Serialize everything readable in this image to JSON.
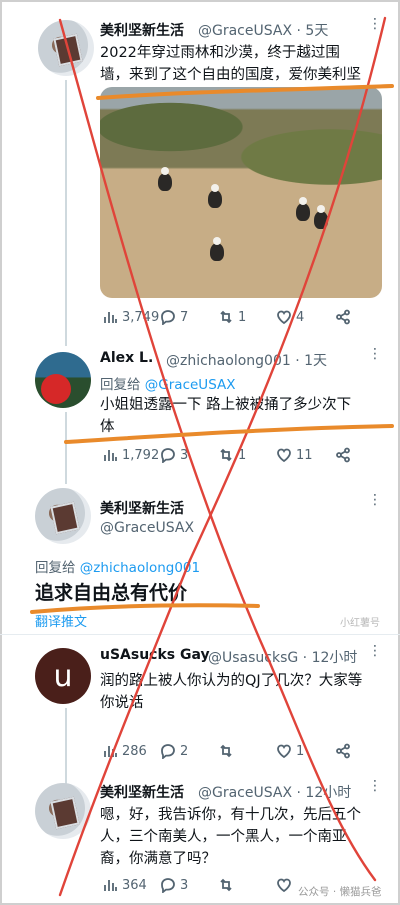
{
  "tweets": [
    {
      "name": "美利坚新生活",
      "handle": "@GraceUSAX · 5天",
      "text_lines": [
        "2022年穿过雨林和沙漠，终于越过围",
        "墙，来到了这个自由的国度，爱你美利坚"
      ],
      "stats": {
        "views": "3,749",
        "replies": "7",
        "retweets": "1",
        "likes": "4"
      }
    },
    {
      "name": "Alex L.",
      "handle": "@zhichaolong001 · 1天",
      "reply_prefix": "回复给",
      "reply_to": "@GraceUSAX",
      "text_lines": [
        "小姐姐透露一下 路上被被捅了多少次下",
        "体"
      ],
      "stats": {
        "views": "1,792",
        "replies": "3",
        "retweets": "1",
        "likes": "11"
      }
    },
    {
      "name": "美利坚新生活",
      "handle": "@GraceUSAX",
      "reply_prefix": "回复给",
      "reply_to": "@zhichaolong001",
      "big_text": "追求自由总有代价",
      "translate": "翻译推文"
    },
    {
      "name": "uSAsucks Gay",
      "handle": "@UsasucksG · 12小时",
      "avatar_letter": "u",
      "text_lines": [
        "润的路上被人你认为的QJ了几次？大家等",
        "你说话"
      ],
      "stats": {
        "views": "286",
        "replies": "2",
        "likes": "1"
      }
    },
    {
      "name": "美利坚新生活",
      "handle": "@GraceUSAX · 12小时",
      "text_lines": [
        "嗯，好，我告诉你，有十几次，先后五个",
        "人，三个南美人，一个黑人，一个南亚",
        "裔，你满意了吗？"
      ],
      "stats": {
        "views": "364",
        "replies": "3"
      }
    }
  ],
  "watermarks": {
    "mid": "小红薯号",
    "bottom": "公众号 · 懒猫兵爸"
  },
  "colors": {
    "annotation_red": "#e0443a",
    "annotation_orange": "#e98a2b",
    "link_blue": "#1d9bf0"
  }
}
